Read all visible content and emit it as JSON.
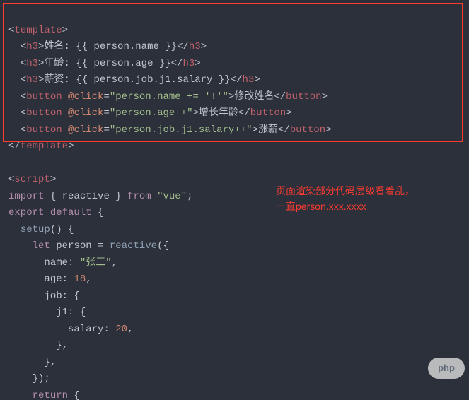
{
  "code": {
    "l1": {
      "open": "<",
      "tag": "template",
      "close": ">"
    },
    "l2": {
      "open": "<",
      "tag": "h3",
      "gt": ">",
      "label": "姓名: ",
      "expr": "{{ person.name }}",
      "copen": "</",
      "cgt": ">"
    },
    "l3": {
      "open": "<",
      "tag": "h3",
      "gt": ">",
      "label": "年龄: ",
      "expr": "{{ person.age }}",
      "copen": "</",
      "cgt": ">"
    },
    "l4": {
      "open": "<",
      "tag": "h3",
      "gt": ">",
      "label": "薪资: ",
      "expr": "{{ person.job.j1.salary }}",
      "copen": "</",
      "cgt": ">"
    },
    "l5": {
      "open": "<",
      "tag": "button",
      "sp": " ",
      "attr": "@click",
      "eq": "=",
      "q": "\"",
      "val": "person.name += '!'",
      "gt": ">",
      "txt": "修改姓名",
      "copen": "</",
      "cgt": ">"
    },
    "l6": {
      "open": "<",
      "tag": "button",
      "sp": " ",
      "attr": "@click",
      "eq": "=",
      "q": "\"",
      "val": "person.age++",
      "gt": ">",
      "txt": "增长年龄",
      "copen": "</",
      "cgt": ">"
    },
    "l7": {
      "open": "<",
      "tag": "button",
      "sp": " ",
      "attr": "@click",
      "eq": "=",
      "q": "\"",
      "val": "person.job.j1.salary++",
      "gt": ">",
      "txt": "涨薪",
      "copen": "</",
      "cgt": ">"
    },
    "l8": {
      "open": "</",
      "tag": "template",
      "close": ">"
    },
    "l9": "",
    "l10": {
      "open": "<",
      "tag": "script",
      "close": ">"
    },
    "l11": {
      "kw1": "import",
      "brace_o": " { ",
      "ident": "reactive",
      "brace_c": " } ",
      "kw2": "from",
      "sp": " ",
      "q": "\"",
      "mod": "vue",
      "semi": ";"
    },
    "l12": {
      "kw1": "export",
      "sp": " ",
      "kw2": "default",
      "brace": " {"
    },
    "l13": {
      "fn": "setup",
      "paren": "()",
      "brace": " {"
    },
    "l14": {
      "kw": "let",
      "sp": " ",
      "ident": "person",
      "eq": " = ",
      "fn": "reactive",
      "paren": "({"
    },
    "l15": {
      "prop": "name",
      "colon": ": ",
      "q": "\"",
      "val": "张三",
      "comma": ","
    },
    "l16": {
      "prop": "age",
      "colon": ": ",
      "val": "18",
      "comma": ","
    },
    "l17": {
      "prop": "job",
      "colon": ": ",
      "brace": "{"
    },
    "l18": {
      "prop": "j1",
      "colon": ": ",
      "brace": "{"
    },
    "l19": {
      "prop": "salary",
      "colon": ": ",
      "val": "20",
      "comma": ","
    },
    "l20": {
      "brace": "},",
      "pad": ""
    },
    "l21": {
      "brace": "},",
      "pad": ""
    },
    "l22": {
      "brace": "});",
      "pad": ""
    },
    "l23": {
      "kw": "return",
      "brace": " {"
    }
  },
  "annotation": {
    "line1": "页面渲染部分代码层级看着乱，",
    "line2": "一直person.xxx.xxxx"
  },
  "watermark": {
    "text": "php"
  }
}
